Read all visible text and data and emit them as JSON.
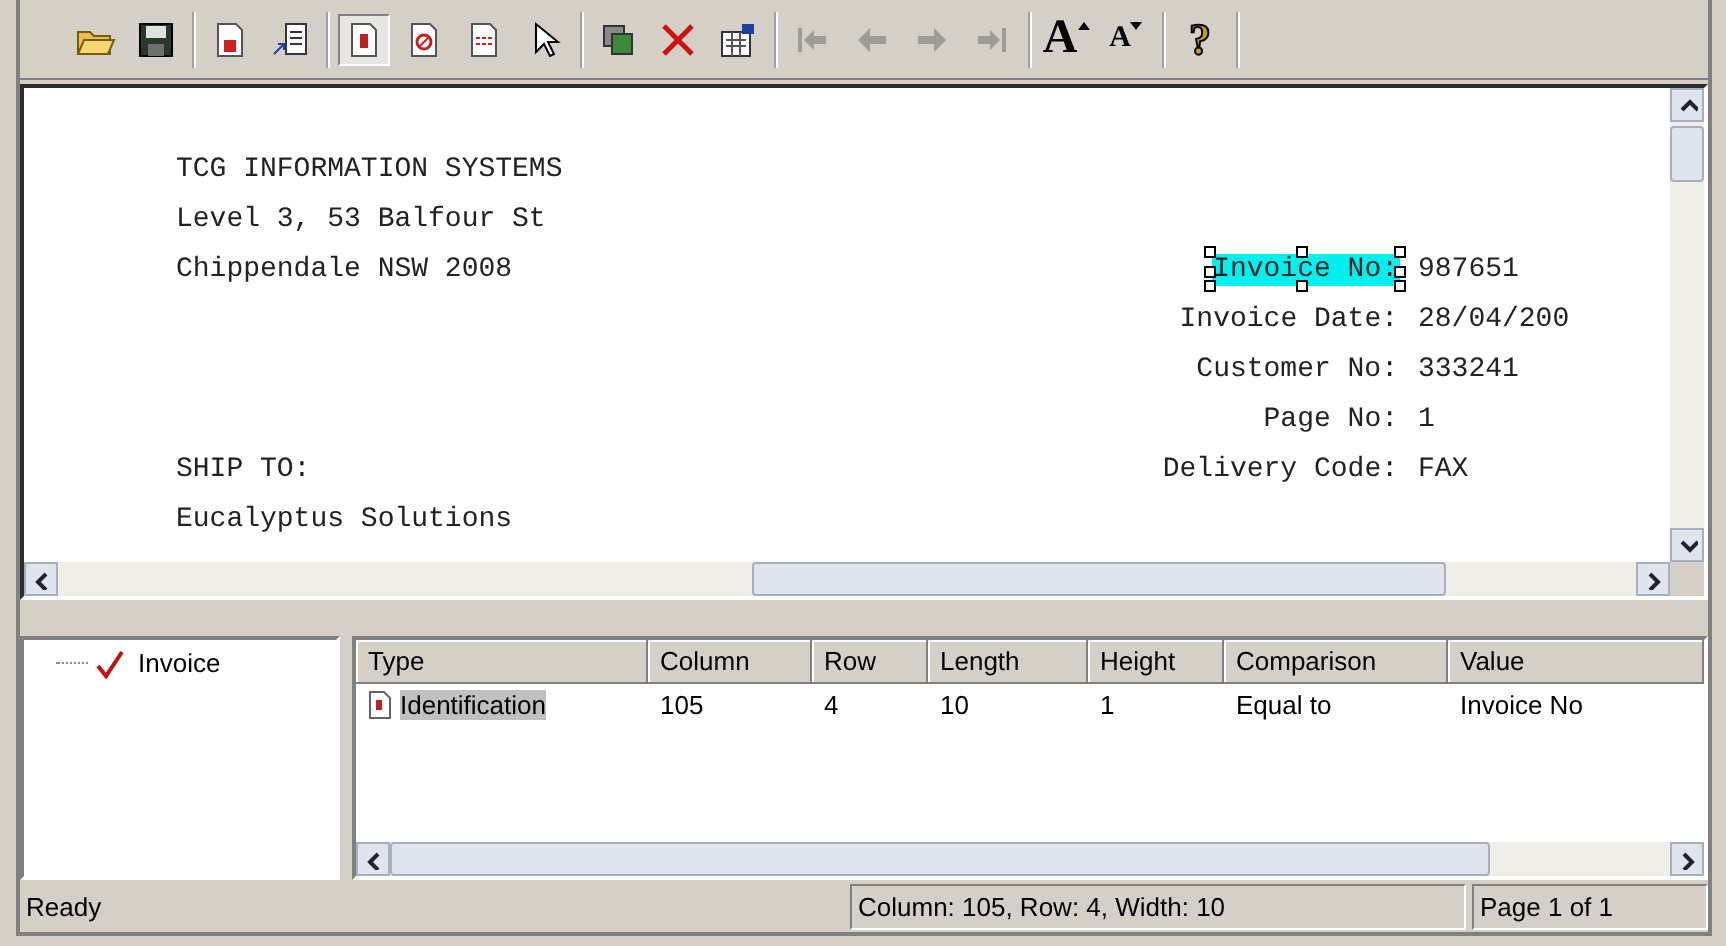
{
  "toolbar": {
    "groups": [
      [
        {
          "kind": "folder",
          "disabled": false,
          "pressed": false
        },
        {
          "kind": "disk",
          "disabled": false,
          "pressed": false
        }
      ],
      [
        {
          "kind": "doc-e",
          "disabled": false,
          "pressed": false
        },
        {
          "kind": "doc-arrow",
          "disabled": false,
          "pressed": false
        }
      ],
      [
        {
          "kind": "doc-mark",
          "disabled": false,
          "pressed": true
        },
        {
          "kind": "doc-stop",
          "disabled": false,
          "pressed": false
        },
        {
          "kind": "doc-lines",
          "disabled": false,
          "pressed": false
        },
        {
          "kind": "pointer",
          "disabled": false,
          "pressed": false
        }
      ],
      [
        {
          "kind": "copy",
          "disabled": false,
          "pressed": false
        },
        {
          "kind": "delete",
          "disabled": false,
          "pressed": false
        },
        {
          "kind": "properties",
          "disabled": false,
          "pressed": false
        }
      ],
      [
        {
          "kind": "first",
          "disabled": true,
          "pressed": false
        },
        {
          "kind": "prev",
          "disabled": true,
          "pressed": false
        },
        {
          "kind": "next",
          "disabled": true,
          "pressed": false
        },
        {
          "kind": "last",
          "disabled": true,
          "pressed": false
        }
      ],
      [
        {
          "kind": "font-up",
          "label": "A",
          "disabled": false,
          "pressed": false
        },
        {
          "kind": "font-down",
          "label": "A",
          "disabled": false,
          "pressed": false
        }
      ],
      [
        {
          "kind": "help",
          "label": "?",
          "disabled": false,
          "pressed": false
        }
      ]
    ]
  },
  "document": {
    "lines": [
      {
        "left": "TCG INFORMATION SYSTEMS"
      },
      {
        "left": "Level 3, 53 Balfour St"
      },
      {
        "left": "Chippendale NSW 2008",
        "label": "Invoice No:",
        "value": "987651",
        "selected": true
      },
      {
        "label": "Invoice Date:",
        "value": "28/04/200",
        "selected": false
      },
      {
        "label": "Customer No:",
        "value": "333241",
        "selected": false
      },
      {
        "label": "Page No:",
        "value": "1",
        "selected": false
      },
      {
        "left": "SHIP TO:",
        "label": "Delivery Code:",
        "value": "FAX",
        "selected": false
      },
      {
        "left": "Eucalyptus Solutions"
      }
    ]
  },
  "tree": {
    "items": [
      {
        "label": "Invoice",
        "checked": true,
        "selected": false
      }
    ]
  },
  "table": {
    "columns": [
      "Type",
      "Column",
      "Row",
      "Length",
      "Height",
      "Comparison",
      "Value"
    ],
    "rows": [
      {
        "cells": [
          "Identification",
          "105",
          "4",
          "10",
          "1",
          "Equal to",
          "Invoice No"
        ],
        "selected": true
      }
    ]
  },
  "status_bar": {
    "message": "Ready",
    "position": "Column: 105, Row: 4, Width: 10",
    "page": "Page 1 of 1"
  }
}
